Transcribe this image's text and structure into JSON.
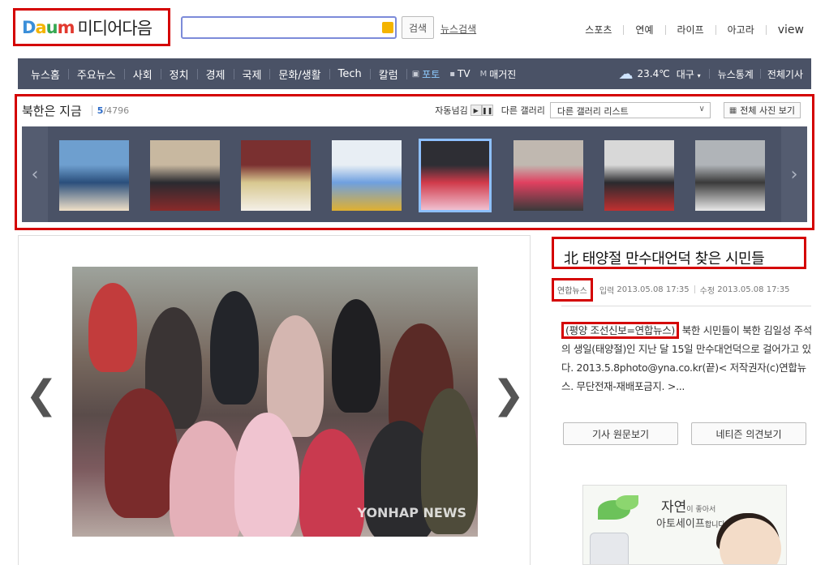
{
  "header": {
    "logo_daum": "Daum",
    "logo_media": "미디어다음",
    "search_button": "검색",
    "news_search_link": "뉴스검색",
    "top_links": [
      "스포츠",
      "연예",
      "라이프",
      "아고라",
      "view"
    ]
  },
  "nav": {
    "items": [
      "뉴스홈",
      "주요뉴스",
      "사회",
      "정치",
      "경제",
      "국제",
      "문화/생활",
      "Tech",
      "칼럼"
    ],
    "sub_items": [
      {
        "icon": "camera-icon",
        "label": "포토",
        "active": true
      },
      {
        "icon": "tv-icon",
        "label": "TV",
        "active": false
      },
      {
        "icon": "magazine-icon",
        "label": "매거진",
        "active": false
      }
    ],
    "weather_temp": "23.4℃",
    "weather_city": "대구",
    "news_stats": "뉴스통계",
    "all_articles": "전체기사"
  },
  "gallery": {
    "title": "북한은 지금",
    "current": "5",
    "total": "/4796",
    "autoplay_label": "자동넘김",
    "other_gallery_label": "다른 갤러리",
    "select_value": "다른 갤러리 리스트",
    "all_photos_button": "전체 사진 보기",
    "selected_index": 4,
    "thumb_count": 8
  },
  "main_photo": {
    "watermark": "YONHAP NEWS"
  },
  "article": {
    "title": "北 태양절 만수대언덕 찾은 시민들",
    "press": "연합뉴스",
    "input_label": "입력",
    "input_time": "2013.05.08 17:35",
    "modified_label": "수정",
    "modified_time": "2013.05.08 17:35",
    "byline": "(평양 조선신보=연합뉴스)",
    "body": " 북한 시민들이 북한 김일성 주석의 생일(태양절)인 지난 달 15일 만수대언덕으로 걸어가고 있다. 2013.5.8photo@yna.co.kr(끝)< 저작권자(c)연합뉴스. 무단전재-재배포금지. >...",
    "btn_original": "기사 원문보기",
    "btn_comments": "네티즌 의견보기"
  },
  "ad": {
    "title": "자연",
    "title_small": "이 좋아서",
    "brand": "아토세이프",
    "brand_small": "합니다"
  }
}
